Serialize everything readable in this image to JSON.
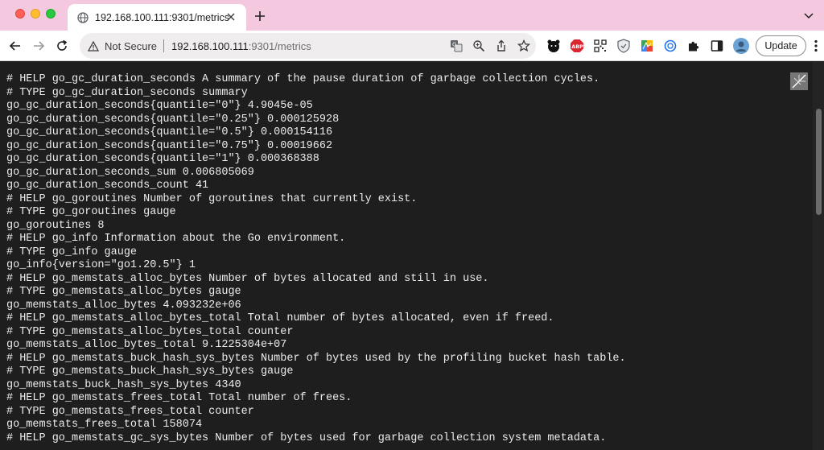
{
  "tab": {
    "title": "192.168.100.111:9301/metrics"
  },
  "omnibox": {
    "security_label": "Not Secure",
    "host": "192.168.100.111",
    "rest": ":9301/metrics"
  },
  "toolbar": {
    "update_label": "Update"
  },
  "metrics_lines": [
    "# HELP go_gc_duration_seconds A summary of the pause duration of garbage collection cycles.",
    "# TYPE go_gc_duration_seconds summary",
    "go_gc_duration_seconds{quantile=\"0\"} 4.9045e-05",
    "go_gc_duration_seconds{quantile=\"0.25\"} 0.000125928",
    "go_gc_duration_seconds{quantile=\"0.5\"} 0.000154116",
    "go_gc_duration_seconds{quantile=\"0.75\"} 0.00019662",
    "go_gc_duration_seconds{quantile=\"1\"} 0.000368388",
    "go_gc_duration_seconds_sum 0.006805069",
    "go_gc_duration_seconds_count 41",
    "# HELP go_goroutines Number of goroutines that currently exist.",
    "# TYPE go_goroutines gauge",
    "go_goroutines 8",
    "# HELP go_info Information about the Go environment.",
    "# TYPE go_info gauge",
    "go_info{version=\"go1.20.5\"} 1",
    "# HELP go_memstats_alloc_bytes Number of bytes allocated and still in use.",
    "# TYPE go_memstats_alloc_bytes gauge",
    "go_memstats_alloc_bytes 4.093232e+06",
    "# HELP go_memstats_alloc_bytes_total Total number of bytes allocated, even if freed.",
    "# TYPE go_memstats_alloc_bytes_total counter",
    "go_memstats_alloc_bytes_total 9.1225304e+07",
    "# HELP go_memstats_buck_hash_sys_bytes Number of bytes used by the profiling bucket hash table.",
    "# TYPE go_memstats_buck_hash_sys_bytes gauge",
    "go_memstats_buck_hash_sys_bytes 4340",
    "# HELP go_memstats_frees_total Total number of frees.",
    "# TYPE go_memstats_frees_total counter",
    "go_memstats_frees_total 158074",
    "# HELP go_memstats_gc_sys_bytes Number of bytes used for garbage collection system metadata."
  ],
  "colors": {
    "tabstrip": "#f4c9df",
    "content_background": "#1e1e1e",
    "content_text": "#ececec"
  },
  "icons": {
    "window_controls": [
      "close-window-icon",
      "minimize-window-icon",
      "maximize-window-icon"
    ],
    "tab": [
      "globe-favicon-icon",
      "close-tab-icon"
    ],
    "tabstrip": [
      "new-tab-plus-icon",
      "tab-search-chevron-icon"
    ],
    "navigation": [
      "back-arrow-icon",
      "forward-arrow-icon",
      "reload-icon"
    ],
    "omnibox": [
      "warning-triangle-icon",
      "translate-icon",
      "zoom-icon",
      "share-icon",
      "bookmark-star-icon"
    ],
    "extensions": [
      "bear-extension-icon",
      "abp-extension-icon",
      "qr-extension-icon",
      "shield-extension-icon",
      "color-grid-extension-icon",
      "circle-extension-icon",
      "puzzle-extensions-icon",
      "side-panel-icon",
      "avatar-icon"
    ],
    "menu": "kebab-menu-icon",
    "page_overlay": "extension-overlay-icon"
  }
}
